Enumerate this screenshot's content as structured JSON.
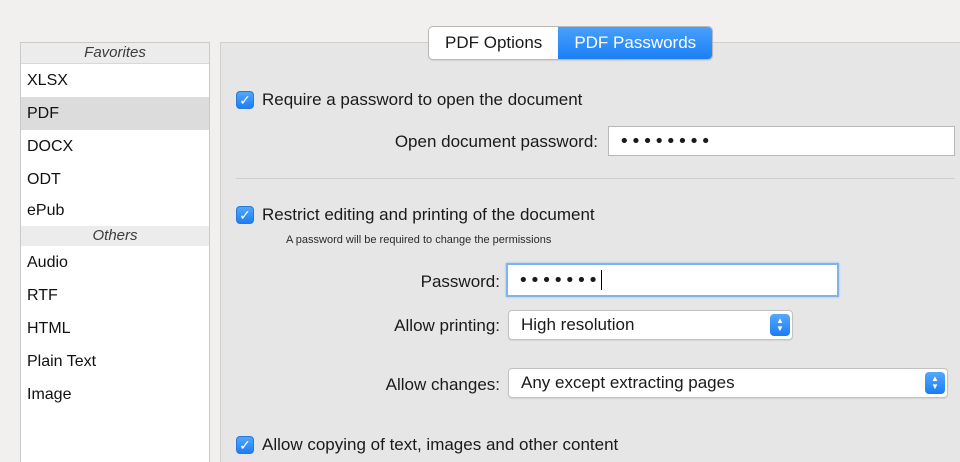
{
  "sidebar": {
    "favorites_header": "Favorites",
    "favorites": [
      "XLSX",
      "PDF",
      "DOCX",
      "ODT",
      "ePub"
    ],
    "selected": "PDF",
    "others_header": "Others",
    "others": [
      "Audio",
      "RTF",
      "HTML",
      "Plain Text",
      "Image"
    ]
  },
  "tabs": {
    "items": [
      "PDF Options",
      "PDF Passwords"
    ],
    "active": "PDF Passwords"
  },
  "open_password": {
    "checkbox_label": "Require a password to open the document",
    "checked": true,
    "field_label": "Open document password:",
    "value": "••••••••"
  },
  "restrict": {
    "checkbox_label": "Restrict editing and printing of the document",
    "checked": true,
    "note": "A password will be required to change the permissions",
    "password_label": "Password:",
    "password_value": "•••••••",
    "printing_label": "Allow printing:",
    "printing_value": "High resolution",
    "changes_label": "Allow changes:",
    "changes_value": "Any except extracting pages"
  },
  "copying": {
    "checkbox_label": "Allow copying of text, images and other content",
    "checked": true
  },
  "colors": {
    "accent": "#1d7ff5",
    "sidebar_selected": "#dcdcdc"
  }
}
